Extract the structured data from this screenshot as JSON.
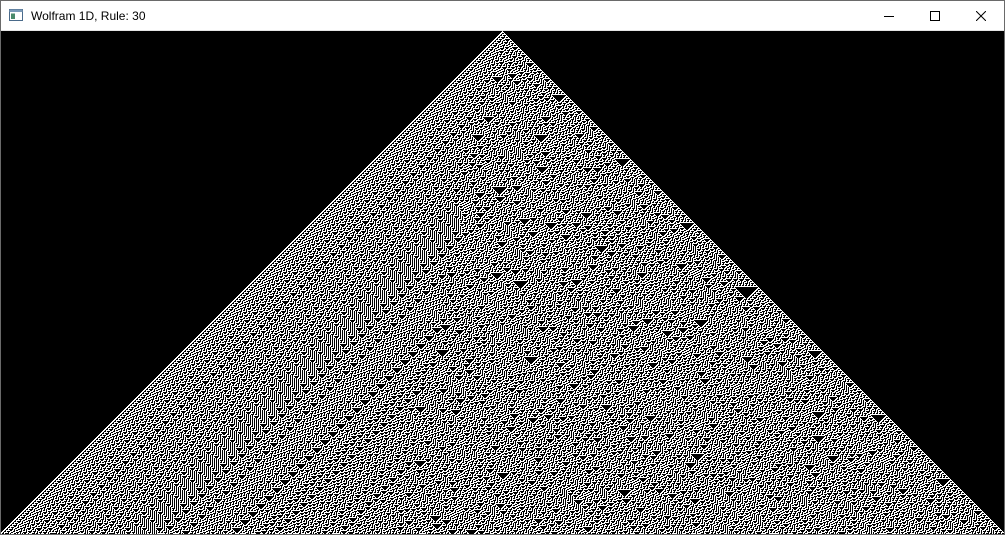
{
  "window": {
    "title": "Wolfram 1D, Rule: 30"
  },
  "titlebar_buttons": {
    "minimize_icon": "minimize-icon",
    "maximize_icon": "maximize-icon",
    "close_icon": "close-icon"
  },
  "automaton": {
    "rule": 30,
    "initial_state": "single live cell at center",
    "live_color": "#ffffff",
    "dead_color": "#000000"
  },
  "colors": {
    "titlebar_bg": "#ffffff",
    "title_text": "#000000",
    "canvas_bg": "#000000"
  }
}
